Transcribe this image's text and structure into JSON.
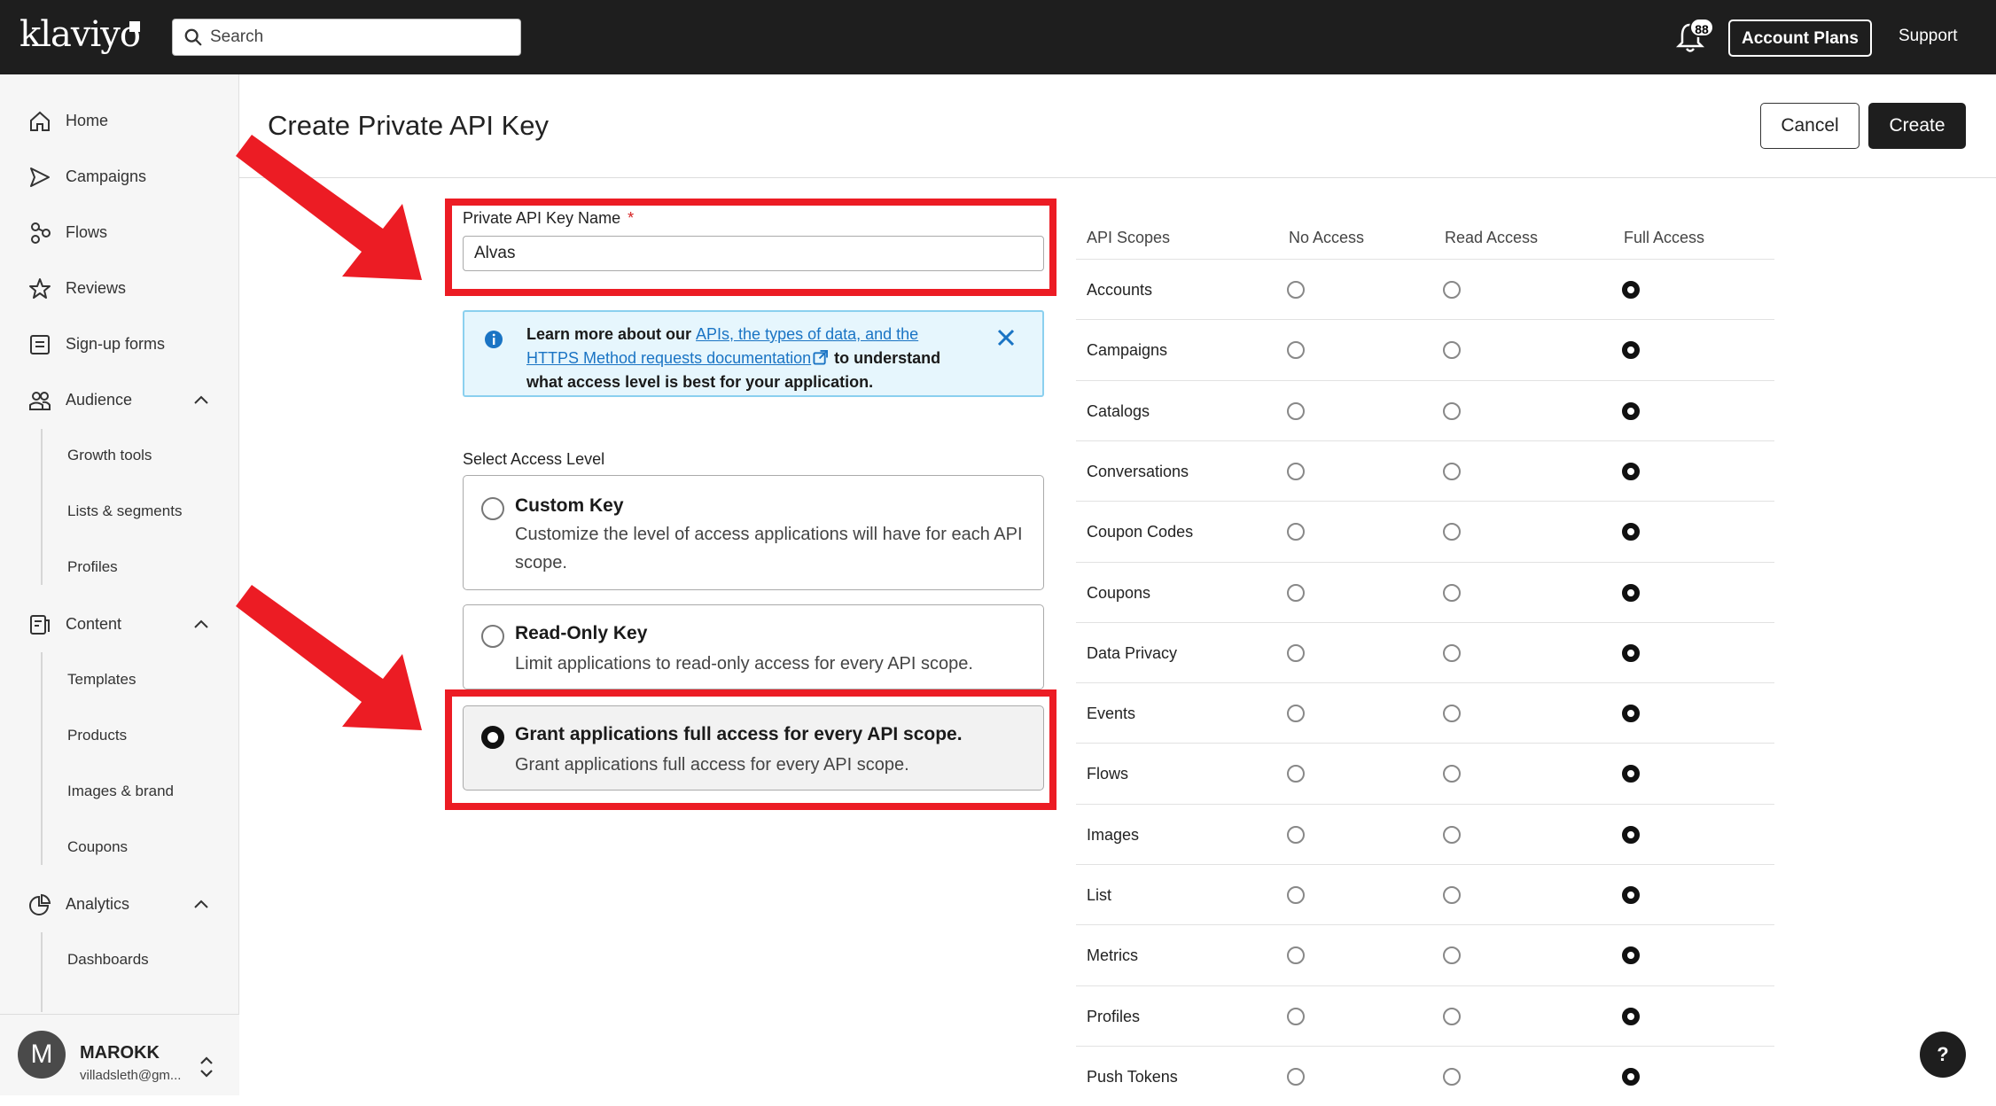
{
  "topbar": {
    "logo": "klaviyo",
    "search_placeholder": "Search",
    "notification_count": "88",
    "account_plans": "Account Plans",
    "support": "Support"
  },
  "sidebar": {
    "items": [
      {
        "label": "Home",
        "icon": "home-icon"
      },
      {
        "label": "Campaigns",
        "icon": "send-icon"
      },
      {
        "label": "Flows",
        "icon": "flows-icon"
      },
      {
        "label": "Reviews",
        "icon": "star-icon"
      },
      {
        "label": "Sign-up forms",
        "icon": "form-icon"
      },
      {
        "label": "Audience",
        "icon": "audience-icon"
      },
      {
        "label": "Content",
        "icon": "content-icon"
      },
      {
        "label": "Analytics",
        "icon": "analytics-icon"
      }
    ],
    "audience_sub": [
      "Growth tools",
      "Lists & segments",
      "Profiles"
    ],
    "content_sub": [
      "Templates",
      "Products",
      "Images & brand",
      "Coupons"
    ],
    "analytics_sub": [
      "Dashboards"
    ],
    "user": {
      "initial": "M",
      "name": "MAROKK",
      "email": "villadsleth@gm..."
    }
  },
  "header": {
    "title": "Create Private API Key",
    "cancel": "Cancel",
    "create": "Create"
  },
  "form": {
    "name_label": "Private API Key Name",
    "required_mark": "*",
    "name_value": "Alvas",
    "info": {
      "lead": "Learn more about our ",
      "link": "APIs, the types of data, and the HTTPS Method requests documentation",
      "tail": " to understand what access level is best for your application."
    },
    "access_label": "Select Access Level",
    "options": [
      {
        "title": "Custom Key",
        "desc": "Customize the level of access applications will have for each API scope.",
        "selected": false
      },
      {
        "title": "Read-Only Key",
        "desc": "Limit applications to read-only access for every API scope.",
        "selected": false
      },
      {
        "title": "Grant applications full access for every API scope.",
        "desc": "Grant applications full access for every API scope.",
        "selected": true
      }
    ]
  },
  "scopes": {
    "headers": [
      "API Scopes",
      "No Access",
      "Read Access",
      "Full Access"
    ],
    "rows": [
      {
        "name": "Accounts",
        "access": "Full Access"
      },
      {
        "name": "Campaigns",
        "access": "Full Access"
      },
      {
        "name": "Catalogs",
        "access": "Full Access"
      },
      {
        "name": "Conversations",
        "access": "Full Access"
      },
      {
        "name": "Coupon Codes",
        "access": "Full Access"
      },
      {
        "name": "Coupons",
        "access": "Full Access"
      },
      {
        "name": "Data Privacy",
        "access": "Full Access"
      },
      {
        "name": "Events",
        "access": "Full Access"
      },
      {
        "name": "Flows",
        "access": "Full Access"
      },
      {
        "name": "Images",
        "access": "Full Access"
      },
      {
        "name": "List",
        "access": "Full Access"
      },
      {
        "name": "Metrics",
        "access": "Full Access"
      },
      {
        "name": "Profiles",
        "access": "Full Access"
      },
      {
        "name": "Push Tokens",
        "access": "Full Access"
      }
    ]
  },
  "help_label": "?",
  "colors": {
    "annotation_red": "#ec1c24",
    "topbar": "#1e1e1e",
    "info_bg": "#e6f6fd",
    "link": "#1a74c4"
  }
}
